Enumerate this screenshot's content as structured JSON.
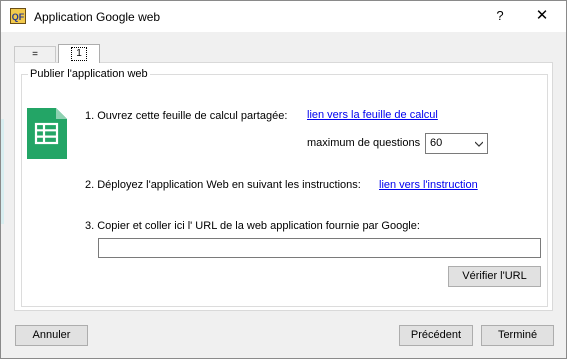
{
  "window": {
    "title": "Application Google web",
    "help_label": "?",
    "close_label": "✕",
    "app_icon_text": "QF"
  },
  "tabs": [
    {
      "label": "="
    },
    {
      "label": "1"
    }
  ],
  "group": {
    "title": "Publier l'application web"
  },
  "steps": {
    "step1_text": "1. Ouvrez cette feuille de calcul partagée:",
    "step1_link": "lien vers la feuille de calcul",
    "max_questions_label": "maximum de questions",
    "max_questions_value": "60",
    "step2_text": "2. Déployez l'application Web en suivant les instructions:",
    "step2_link": "lien vers l'instruction",
    "step3_text": "3. Copier et coller ici l' URL de la web application fournie par Google:",
    "url_value": ""
  },
  "buttons": {
    "verify": "Vérifier l'URL",
    "cancel": "Annuler",
    "previous": "Précédent",
    "done": "Terminé"
  },
  "colors": {
    "sheets_green": "#23a566",
    "link_blue": "#0000ee"
  },
  "icons": {
    "sheets": "google-sheets-icon",
    "chevron": "chevron-down-icon"
  }
}
